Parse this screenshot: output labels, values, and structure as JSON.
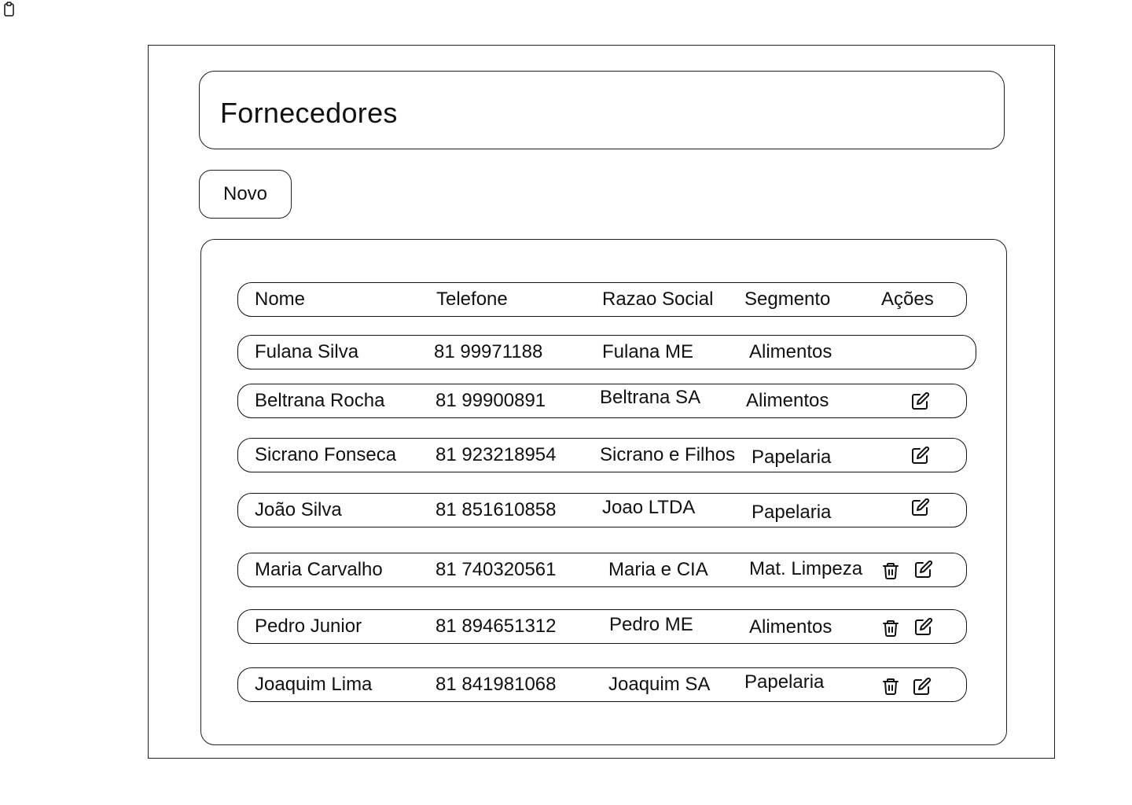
{
  "page": {
    "title": "Fornecedores",
    "new_button_label": "Novo"
  },
  "icons": {
    "corner": "clipboard-icon",
    "delete": "trash-icon",
    "edit": "edit-icon"
  },
  "table": {
    "headers": [
      "Nome",
      "Telefone",
      "Razao Social",
      "Segmento",
      "Ações"
    ],
    "rows": [
      {
        "nome": "Fulana Silva",
        "telefone": "81 99971188",
        "razao_social": "Fulana ME",
        "segmento": "Alimentos",
        "actions": []
      },
      {
        "nome": "Beltrana Rocha",
        "telefone": "81 99900891",
        "razao_social": "Beltrana SA",
        "segmento": "Alimentos",
        "actions": [
          "edit"
        ]
      },
      {
        "nome": "Sicrano Fonseca",
        "telefone": "81 923218954",
        "razao_social": "Sicrano e Filhos",
        "segmento": "Papelaria",
        "actions": [
          "edit"
        ]
      },
      {
        "nome": "João Silva",
        "telefone": "81 851610858",
        "razao_social": "Joao LTDA",
        "segmento": "Papelaria",
        "actions": [
          "edit"
        ]
      },
      {
        "nome": "Maria Carvalho",
        "telefone": "81 740320561",
        "razao_social": "Maria e CIA",
        "segmento": "Mat. Limpeza",
        "actions": [
          "delete",
          "edit"
        ]
      },
      {
        "nome": "Pedro Junior",
        "telefone": "81 894651312",
        "razao_social": "Pedro ME",
        "segmento": "Alimentos",
        "actions": [
          "delete",
          "edit"
        ]
      },
      {
        "nome": "Joaquim Lima",
        "telefone": "81 841981068",
        "razao_social": "Joaquim SA",
        "segmento": "Papelaria",
        "actions": [
          "delete",
          "edit"
        ]
      }
    ]
  }
}
